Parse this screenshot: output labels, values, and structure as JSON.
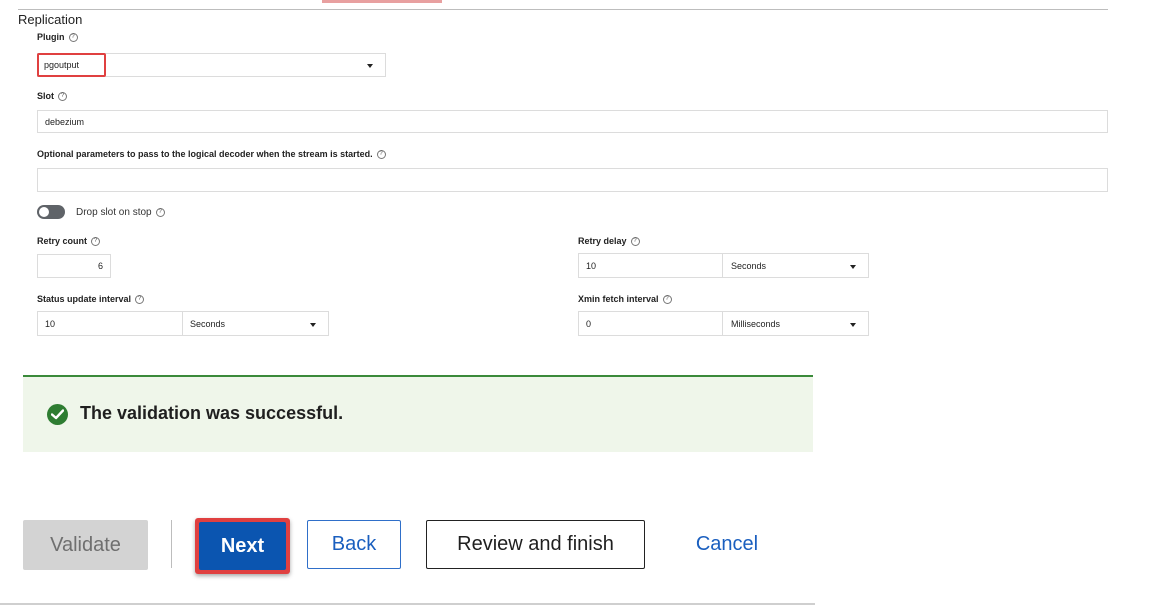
{
  "section": {
    "title": "Replication"
  },
  "plugin": {
    "label": "Plugin",
    "value": "pgoutput"
  },
  "slot": {
    "label": "Slot",
    "value": "debezium"
  },
  "decoder_params": {
    "label": "Optional parameters to pass to the logical decoder when the stream is started.",
    "value": ""
  },
  "drop_slot": {
    "label": "Drop slot on stop",
    "enabled": false
  },
  "retry_count": {
    "label": "Retry count",
    "value": "6"
  },
  "retry_delay": {
    "label": "Retry delay",
    "value": "10",
    "unit": "Seconds"
  },
  "status_interval": {
    "label": "Status update interval",
    "value": "10",
    "unit": "Seconds"
  },
  "xmin_interval": {
    "label": "Xmin fetch interval",
    "value": "0",
    "unit": "Milliseconds"
  },
  "banner": {
    "message": "The validation was successful.",
    "color": "#2e7d32"
  },
  "buttons": {
    "validate": "Validate",
    "next": "Next",
    "back": "Back",
    "review": "Review and finish",
    "cancel": "Cancel"
  },
  "colors": {
    "primary": "#0b55b0",
    "highlight": "#e04040",
    "link": "#1a5fbf"
  }
}
